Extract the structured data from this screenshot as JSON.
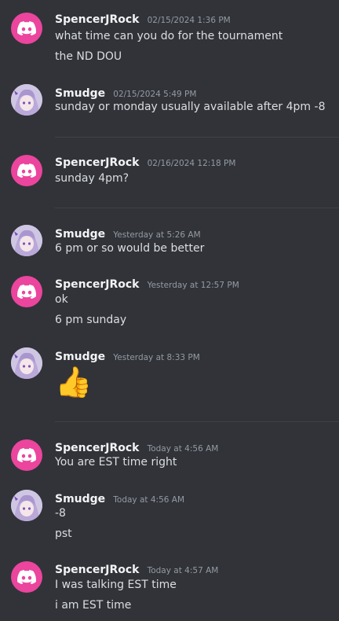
{
  "colors": {
    "background": "#313338",
    "discord_avatar": "#eb459e",
    "author": "#f2f3f5",
    "timestamp": "#949ba4",
    "message": "#dbdee1"
  },
  "messages": [
    {
      "author": "SpencerJRock",
      "timestamp": "02/15/2024 1:36 PM",
      "avatar": "discord-logo-icon",
      "lines": [
        "what time can you do for the tournament",
        "the ND DOU"
      ]
    },
    {
      "author": "Smudge",
      "timestamp": "02/15/2024 5:49 PM",
      "avatar": "anime-avatar",
      "lines": [
        "sunday or monday usually available after 4pm -8"
      ]
    },
    {
      "author": "SpencerJRock",
      "timestamp": "02/16/2024 12:18 PM",
      "avatar": "discord-logo-icon",
      "lines": [
        "sunday 4pm?"
      ]
    },
    {
      "author": "Smudge",
      "timestamp": "Yesterday at 5:26 AM",
      "avatar": "anime-avatar",
      "lines": [
        "6 pm or so would be better"
      ]
    },
    {
      "author": "SpencerJRock",
      "timestamp": "Yesterday at 12:57 PM",
      "avatar": "discord-logo-icon",
      "lines": [
        "ok",
        "6 pm sunday"
      ]
    },
    {
      "author": "Smudge",
      "timestamp": "Yesterday at 8:33 PM",
      "avatar": "anime-avatar",
      "lines": [
        "👍"
      ]
    },
    {
      "author": "SpencerJRock",
      "timestamp": "Today at 4:56 AM",
      "avatar": "discord-logo-icon",
      "lines": [
        "You are EST time right"
      ]
    },
    {
      "author": "Smudge",
      "timestamp": "Today at 4:56 AM",
      "avatar": "anime-avatar",
      "lines": [
        "-8",
        "pst"
      ]
    },
    {
      "author": "SpencerJRock",
      "timestamp": "Today at 4:57 AM",
      "avatar": "discord-logo-icon",
      "lines": [
        "I was talking EST time",
        "i am EST time"
      ]
    }
  ]
}
